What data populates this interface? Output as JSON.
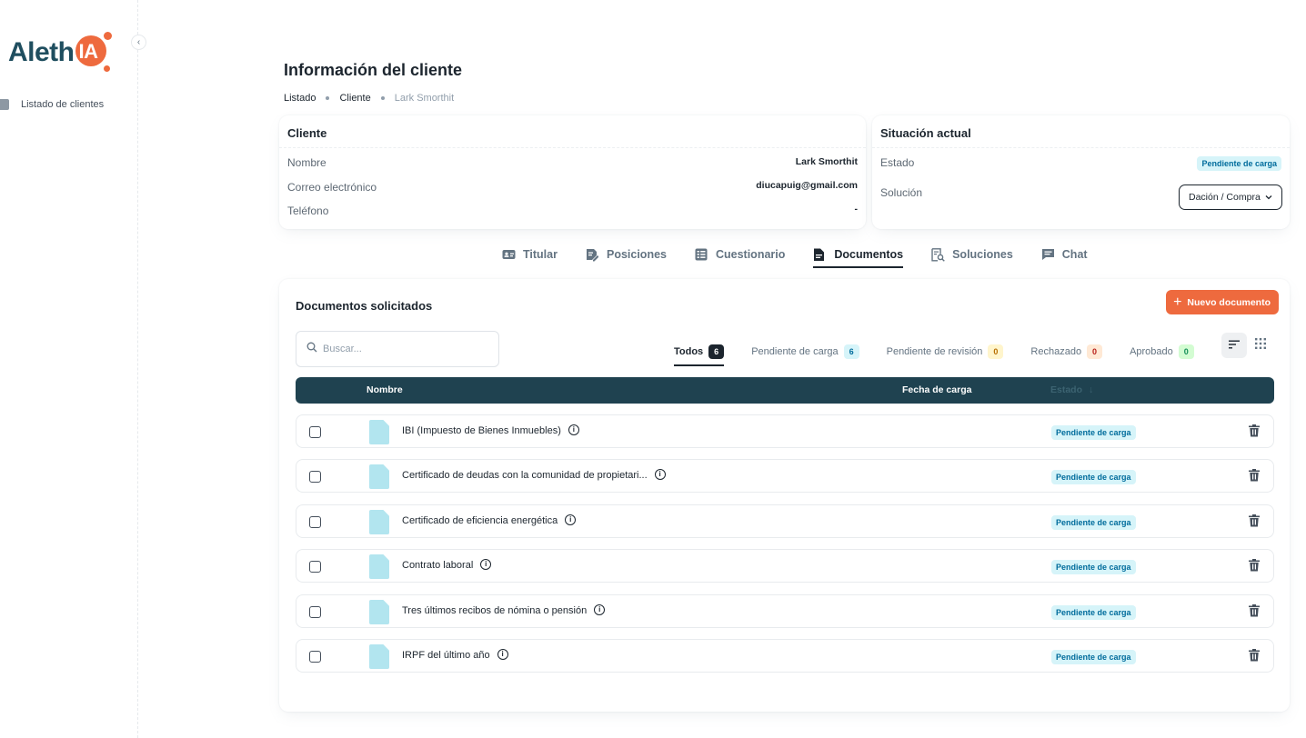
{
  "brand": {
    "prefix": "Aleth",
    "suffix": "IA",
    "color": "#1f4e5f",
    "accent": "#ee6a3e"
  },
  "sidebar": {
    "items": [
      {
        "label": "Listado de clientes",
        "icon": "user-icon"
      }
    ]
  },
  "header": {
    "title": "Información del cliente",
    "breadcrumb": [
      "Listado",
      "Cliente",
      "Lark Smorthit"
    ]
  },
  "client_card": {
    "title": "Cliente",
    "rows": [
      {
        "label": "Nombre",
        "value": "Lark Smorthit"
      },
      {
        "label": "Correo electrónico",
        "value": "diucapuig@gmail.com"
      },
      {
        "label": "Teléfono",
        "value": "-"
      }
    ]
  },
  "status_card": {
    "title": "Situación actual",
    "estado_label": "Estado",
    "estado_value": "Pendiente de carga",
    "solucion_label": "Solución",
    "solucion_value": "Dación / Compra"
  },
  "tabs": [
    {
      "label": "Titular",
      "icon": "id-card-icon",
      "active": false
    },
    {
      "label": "Posiciones",
      "icon": "edit-doc-icon",
      "active": false
    },
    {
      "label": "Cuestionario",
      "icon": "form-icon",
      "active": false
    },
    {
      "label": "Documentos",
      "icon": "document-icon",
      "active": true
    },
    {
      "label": "Soluciones",
      "icon": "search-doc-icon",
      "active": false
    },
    {
      "label": "Chat",
      "icon": "chat-icon",
      "active": false
    }
  ],
  "documents": {
    "title": "Documentos solicitados",
    "new_button": "Nuevo documento",
    "search_placeholder": "Buscar...",
    "filters": [
      {
        "label": "Todos",
        "count": "6",
        "style": "dark",
        "active": true
      },
      {
        "label": "Pendiente de carga",
        "count": "6",
        "style": "info",
        "active": false
      },
      {
        "label": "Pendiente de revisión",
        "count": "0",
        "style": "warn",
        "active": false
      },
      {
        "label": "Rechazado",
        "count": "0",
        "style": "err",
        "active": false
      },
      {
        "label": "Aprobado",
        "count": "0",
        "style": "ok",
        "active": false
      }
    ],
    "columns": {
      "name": "Nombre",
      "date": "Fecha de carga",
      "status": "Estado"
    },
    "rows": [
      {
        "name": "IBI (Impuesto de Bienes Inmuebles)",
        "status": "Pendiente de carga"
      },
      {
        "name": "Certificado de deudas con la comunidad de propietari...",
        "status": "Pendiente de carga"
      },
      {
        "name": "Certificado de eficiencia energética",
        "status": "Pendiente de carga"
      },
      {
        "name": "Contrato laboral",
        "status": "Pendiente de carga"
      },
      {
        "name": "Tres últimos recibos de nómina o pensión",
        "status": "Pendiente de carga"
      },
      {
        "name": "IRPF del último año",
        "status": "Pendiente de carga"
      }
    ]
  }
}
